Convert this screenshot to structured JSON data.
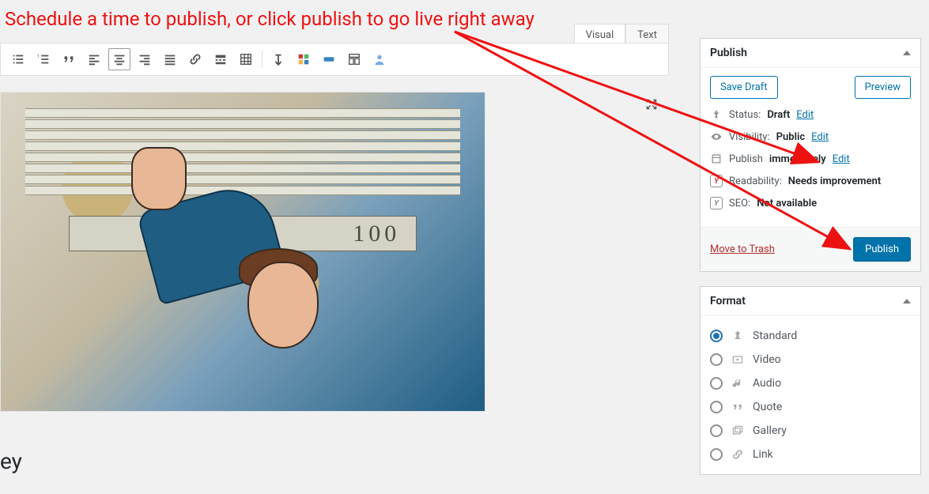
{
  "annotation": {
    "text": "Schedule a time to publish, or click publish to go live right away"
  },
  "editor": {
    "tabs": {
      "visual": "Visual",
      "text": "Text"
    },
    "title_fragment": "ey"
  },
  "publish": {
    "panel_title": "Publish",
    "save_draft": "Save Draft",
    "preview": "Preview",
    "status_label": "Status:",
    "status_value": "Draft",
    "status_edit": "Edit",
    "visibility_label": "Visibility:",
    "visibility_value": "Public",
    "visibility_edit": "Edit",
    "publish_label": "Publish",
    "publish_value": "immediately",
    "publish_edit": "Edit",
    "readability_label": "Readability:",
    "readability_value": "Needs improvement",
    "seo_label": "SEO:",
    "seo_value": "Not available",
    "trash": "Move to Trash",
    "publish_button": "Publish"
  },
  "format": {
    "panel_title": "Format",
    "items": [
      {
        "label": "Standard",
        "selected": true
      },
      {
        "label": "Video",
        "selected": false
      },
      {
        "label": "Audio",
        "selected": false
      },
      {
        "label": "Quote",
        "selected": false
      },
      {
        "label": "Gallery",
        "selected": false
      },
      {
        "label": "Link",
        "selected": false
      }
    ]
  }
}
